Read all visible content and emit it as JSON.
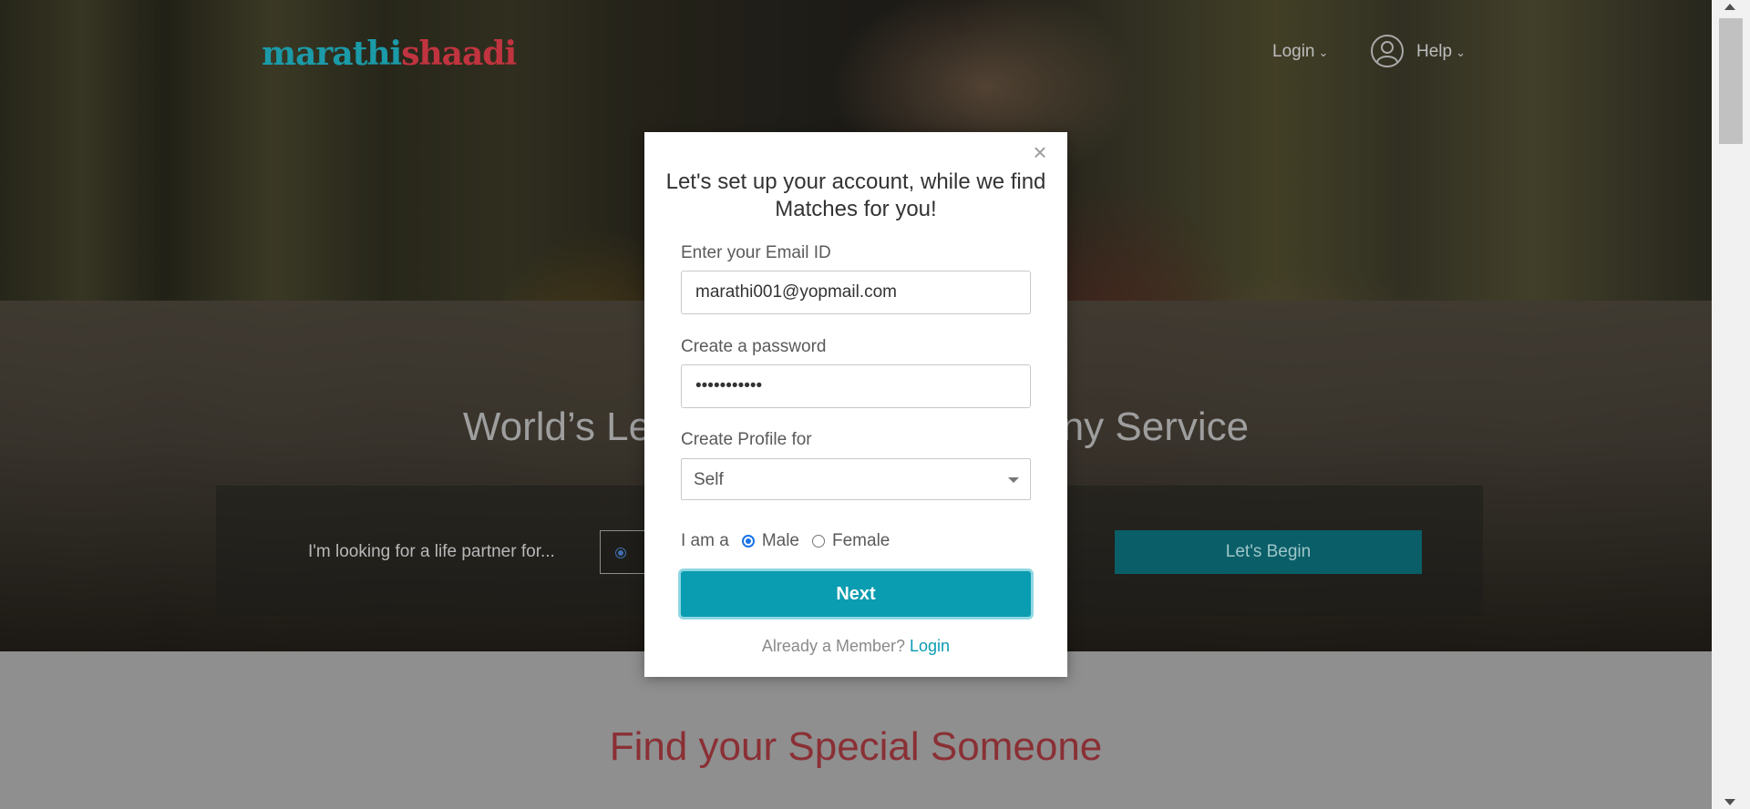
{
  "header": {
    "logo_part1": "marathi",
    "logo_part2": "shaadi",
    "login_label": "Login",
    "help_label": "Help"
  },
  "hero": {
    "title_visible_left": "World’s Le",
    "title_visible_right": "ony Service",
    "looking_for_label": "I'm looking for a life partner for...",
    "begin_button": "Let's Begin"
  },
  "section": {
    "find_title": "Find your Special Someone"
  },
  "modal": {
    "title": "Let's set up your account, while we find Matches for you!",
    "email_label": "Enter your Email ID",
    "email_value": "marathi001@yopmail.com",
    "password_label": "Create a password",
    "password_value": "•••••••••••",
    "profile_for_label": "Create Profile for",
    "profile_for_value": "Self",
    "gender_label": "I am a",
    "gender_options": [
      "Male",
      "Female"
    ],
    "gender_selected": "Male",
    "next_button": "Next",
    "member_text": "Already a Member?",
    "login_link": "Login"
  },
  "colors": {
    "accent": "#0a9cb0",
    "logo_teal": "#1b9aa8",
    "logo_red": "#c0343f",
    "heading_red": "#8a3035"
  },
  "icons": {
    "close": "close-icon",
    "user": "user-icon",
    "chevron": "chevron-down-icon",
    "caret": "caret-down-icon"
  }
}
